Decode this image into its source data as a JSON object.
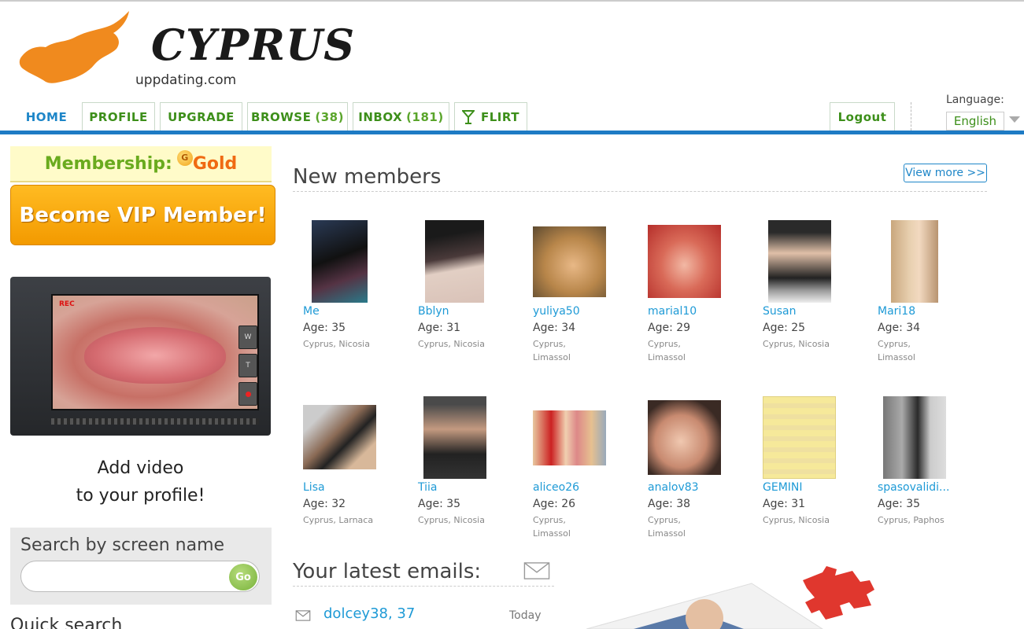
{
  "header": {
    "logo_word": "CYPRUS",
    "logo_sub": "uppdating.com"
  },
  "nav": {
    "home": "HOME",
    "profile": "PROFILE",
    "upgrade": "UPGRADE",
    "browse": "BROWSE",
    "browse_count": "(38)",
    "inbox": "INBOX",
    "inbox_count": "(181)",
    "flirt": "FLIRT",
    "logout": "Logout",
    "language_label": "Language:",
    "language_value": "English"
  },
  "sidebar": {
    "membership_label": "Membership:",
    "membership_coin": "G",
    "membership_level": "Gold",
    "vip_button": "Become VIP Member!",
    "camera_rec": "REC",
    "camera_btn_w": "W",
    "camera_btn_t": "T",
    "add_video_line1": "Add video",
    "add_video_line2": "to your profile!",
    "search_title": "Search by screen name",
    "search_value": "",
    "go_button": "Go",
    "quick_search": "Quick search"
  },
  "new_members": {
    "title": "New members",
    "view_more": "View more >>",
    "members": [
      {
        "name": "Me",
        "age": "Age: 35",
        "location": "Cyprus, Nicosia"
      },
      {
        "name": "Bblyn",
        "age": "Age: 31",
        "location": "Cyprus, Nicosia"
      },
      {
        "name": "yuliya50",
        "age": "Age: 34",
        "location": "Cyprus, Limassol"
      },
      {
        "name": "marial10",
        "age": "Age: 29",
        "location": "Cyprus, Limassol"
      },
      {
        "name": "Susan",
        "age": "Age: 25",
        "location": "Cyprus, Nicosia"
      },
      {
        "name": "Mari18",
        "age": "Age: 34",
        "location": "Cyprus, Limassol"
      },
      {
        "name": "Lisa",
        "age": "Age: 32",
        "location": "Cyprus, Larnaca"
      },
      {
        "name": "Tiia",
        "age": "Age: 35",
        "location": "Cyprus, Nicosia"
      },
      {
        "name": "aliceo26",
        "age": "Age: 26",
        "location": "Cyprus, Limassol"
      },
      {
        "name": "analov83",
        "age": "Age: 38",
        "location": "Cyprus, Limassol"
      },
      {
        "name": "GEMINI",
        "age": "Age: 31",
        "location": "Cyprus, Nicosia"
      },
      {
        "name": "spasovalidi...",
        "age": "Age: 35",
        "location": "Cyprus, Paphos"
      }
    ]
  },
  "emails": {
    "title": "Your latest emails:",
    "items": [
      {
        "from": "dolcey38, 37",
        "date": "Today"
      }
    ]
  },
  "colors": {
    "brand_blue": "#1e7bc4",
    "nav_green": "#3d8f1a",
    "vip_orange": "#f39a00",
    "link_blue": "#1e9ad6"
  }
}
